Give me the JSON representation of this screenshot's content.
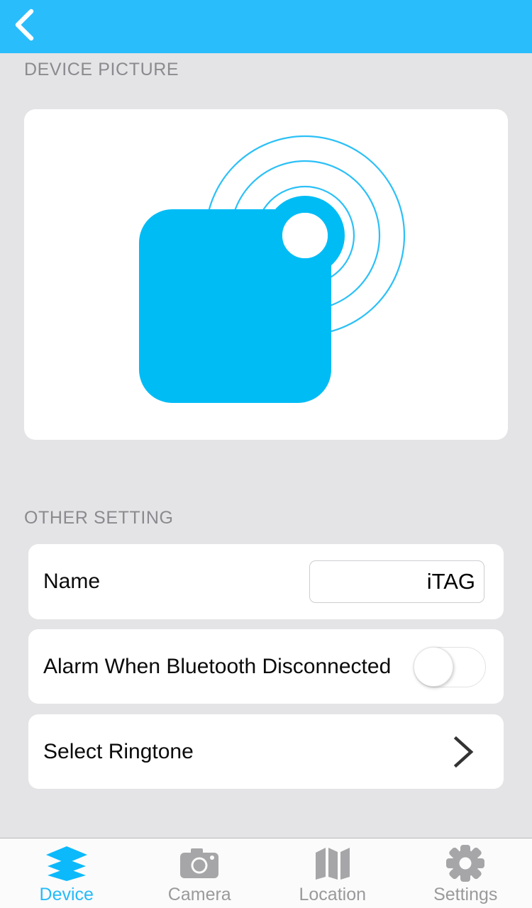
{
  "header": {
    "back_label": "Back",
    "background_color": "#29bdfc"
  },
  "sections": {
    "device_picture_label": "DEVICE PICTURE",
    "other_setting_label": "OTHER SETTING"
  },
  "device_picture": {
    "icon_name": "bluetooth-tracker-tag-icon",
    "accent_color": "#00bcf5"
  },
  "settings": {
    "name_row": {
      "label": "Name",
      "value": "iTAG",
      "placeholder": "iTAG"
    },
    "alarm_row": {
      "label": "Alarm When Bluetooth Disconnected",
      "toggle_state": "off"
    },
    "ringtone_row": {
      "label": "Select Ringtone"
    }
  },
  "tabbar": {
    "active_color": "#25bbfb",
    "inactive_color": "#9a9a9c",
    "tabs": [
      {
        "label": "Device",
        "icon": "layers-icon",
        "active": true
      },
      {
        "label": "Camera",
        "icon": "camera-icon",
        "active": false
      },
      {
        "label": "Location",
        "icon": "map-icon",
        "active": false
      },
      {
        "label": "Settings",
        "icon": "gear-icon",
        "active": false
      }
    ]
  }
}
